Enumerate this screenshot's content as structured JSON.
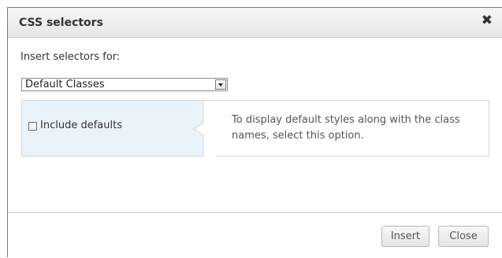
{
  "dialog": {
    "title": "CSS selectors",
    "close_glyph": "✖",
    "close_icon": "close-icon"
  },
  "form": {
    "insert_label": "Insert selectors for:",
    "selector_select": {
      "selected": "Default Classes",
      "icon": "chevron-down-icon"
    },
    "include_defaults": {
      "label": "Include defaults",
      "checked": false
    },
    "help_text": "To display default styles along with the class names, select this option."
  },
  "footer": {
    "insert_label": "Insert",
    "close_label": "Close"
  },
  "colors": {
    "panel_left_bg": "#eaf2fa",
    "panel_border": "#cfd8e0",
    "titlebar_bg": "#eeeeee"
  }
}
